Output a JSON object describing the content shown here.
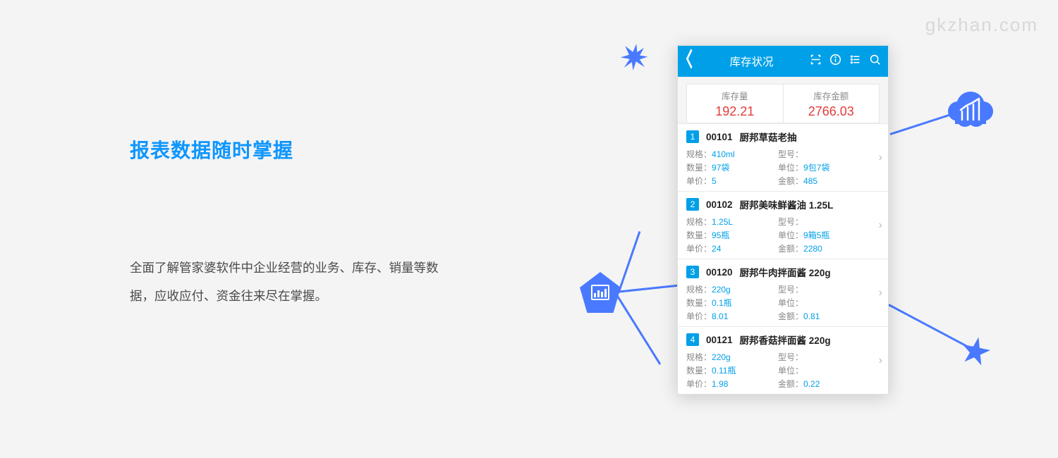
{
  "watermark": "gkzhan.com",
  "heading": "报表数据随时掌握",
  "description": "全面了解管家婆软件中企业经营的业务、库存、销量等数据，应收应付、资金往来尽在掌握。",
  "phone": {
    "header_title": "库存状况",
    "summary": [
      {
        "label": "库存量",
        "value": "192.21"
      },
      {
        "label": "库存金额",
        "value": "2766.03"
      }
    ],
    "field_labels": {
      "spec": "规格：",
      "model": "型号：",
      "qty": "数量：",
      "unit": "单位：",
      "price": "单价：",
      "amount": "金额："
    },
    "items": [
      {
        "idx": "1",
        "code": "00101",
        "name": "厨邦草菇老抽",
        "spec": "410ml",
        "model": "",
        "qty": "97袋",
        "unit": "9包7袋",
        "price": "5",
        "amount": "485"
      },
      {
        "idx": "2",
        "code": "00102",
        "name": "厨邦美味鲜酱油 1.25L",
        "spec": "1.25L",
        "model": "",
        "qty": "95瓶",
        "unit": "9箱5瓶",
        "price": "24",
        "amount": "2280"
      },
      {
        "idx": "3",
        "code": "00120",
        "name": "厨邦牛肉拌面酱 220g",
        "spec": "220g",
        "model": "",
        "qty": "0.1瓶",
        "unit": "",
        "price": "8.01",
        "amount": "0.81"
      },
      {
        "idx": "4",
        "code": "00121",
        "name": "厨邦香菇拌面酱 220g",
        "spec": "220g",
        "model": "",
        "qty": "0.11瓶",
        "unit": "",
        "price": "1.98",
        "amount": "0.22"
      }
    ]
  }
}
